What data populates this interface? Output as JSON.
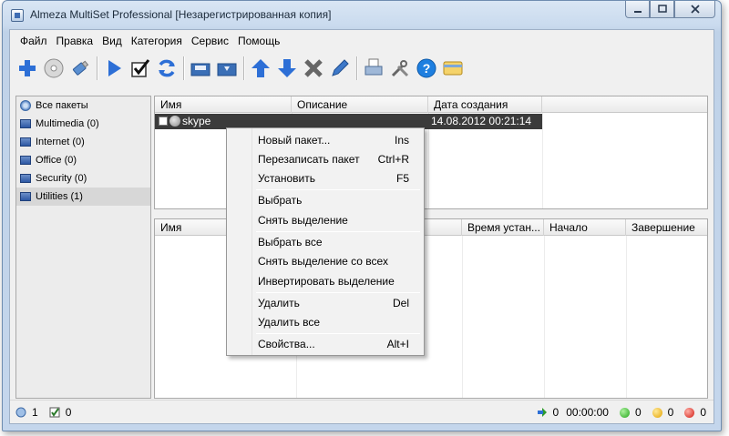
{
  "window": {
    "title": "Almeza MultiSet Professional [Незарегистрированная копия]",
    "controls": {
      "minimize": "—",
      "maximize": "□",
      "close": "✕"
    }
  },
  "menubar": {
    "items": [
      "Файл",
      "Правка",
      "Вид",
      "Категория",
      "Сервис",
      "Помощь"
    ]
  },
  "toolbar": {
    "icons": [
      "add-icon",
      "disc-icon",
      "usb-icon",
      "play-icon",
      "check-icon",
      "refresh-icon",
      "folder-open-icon",
      "folder-save-icon",
      "arrow-up-icon",
      "arrow-down-icon",
      "delete-icon",
      "pencil-icon",
      "printer-icon",
      "tools-icon",
      "help-icon",
      "card-icon"
    ]
  },
  "categories": {
    "items": [
      {
        "label": "Все пакеты",
        "icon": "all-packages-icon",
        "selected": false
      },
      {
        "label": "Multimedia (0)",
        "icon": "folder-icon",
        "selected": false
      },
      {
        "label": "Internet (0)",
        "icon": "folder-icon",
        "selected": false
      },
      {
        "label": "Office (0)",
        "icon": "folder-icon",
        "selected": false
      },
      {
        "label": "Security (0)",
        "icon": "folder-icon",
        "selected": false
      },
      {
        "label": "Utilities (1)",
        "icon": "folder-icon",
        "selected": true
      }
    ]
  },
  "packages_table": {
    "headers": [
      "Имя",
      "Описание",
      "Дата создания"
    ],
    "rows": [
      {
        "name": "skype",
        "description": "",
        "date": "14.08.2012 00:21:14",
        "selected": true
      }
    ]
  },
  "install_table": {
    "headers": [
      "Имя",
      "Время устан...",
      "Начало",
      "Завершение"
    ]
  },
  "context_menu": {
    "items": [
      {
        "label": "Новый пакет...",
        "shortcut": "Ins"
      },
      {
        "label": "Перезаписать пакет",
        "shortcut": "Ctrl+R"
      },
      {
        "label": "Установить",
        "shortcut": "F5"
      },
      {
        "label": "Выбрать",
        "shortcut": ""
      },
      {
        "label": "Снять выделение",
        "shortcut": ""
      },
      {
        "label": "Выбрать все",
        "shortcut": ""
      },
      {
        "label": "Снять выделение со всех",
        "shortcut": ""
      },
      {
        "label": "Инвертировать выделение",
        "shortcut": ""
      },
      {
        "label": "Удалить",
        "shortcut": "Del"
      },
      {
        "label": "Удалить все",
        "shortcut": ""
      },
      {
        "label": "Свойства...",
        "shortcut": "Alt+I"
      }
    ]
  },
  "statusbar": {
    "packages_count": "1",
    "checked_count": "0",
    "install_count": "0",
    "elapsed": "00:00:00",
    "success_count": "0",
    "warning_count": "0",
    "error_count": "0"
  },
  "colors": {
    "selection_dark": "#3b3b3b",
    "toolbar_blue": "#2d6fd6",
    "help_blue": "#1e7fe0"
  }
}
